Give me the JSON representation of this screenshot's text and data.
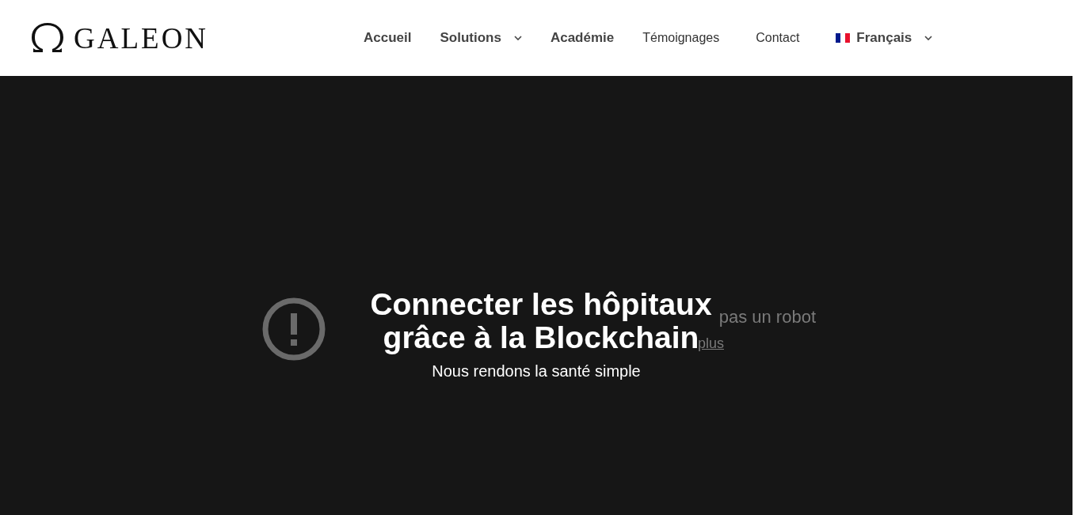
{
  "header": {
    "logo": "GALEON",
    "nav": [
      {
        "label": "Accueil",
        "dropdown": false,
        "flag": false,
        "bold": true
      },
      {
        "label": "Solutions",
        "dropdown": true,
        "flag": false,
        "bold": true
      },
      {
        "label": "Académie",
        "dropdown": false,
        "flag": false,
        "bold": true
      },
      {
        "label": "Témoignages",
        "dropdown": false,
        "flag": false,
        "bold": false
      },
      {
        "label": "Contact",
        "dropdown": false,
        "flag": false,
        "bold": false
      },
      {
        "label": "Français",
        "dropdown": true,
        "flag": true,
        "bold": true
      }
    ]
  },
  "video_error": {
    "title": "pas un robot",
    "link": "plus"
  },
  "hero": {
    "title_lines": [
      "Connecter les hôpitaux",
      "grâce à la Blockchain"
    ],
    "subtitle": "Nous rendons la santé simple"
  }
}
